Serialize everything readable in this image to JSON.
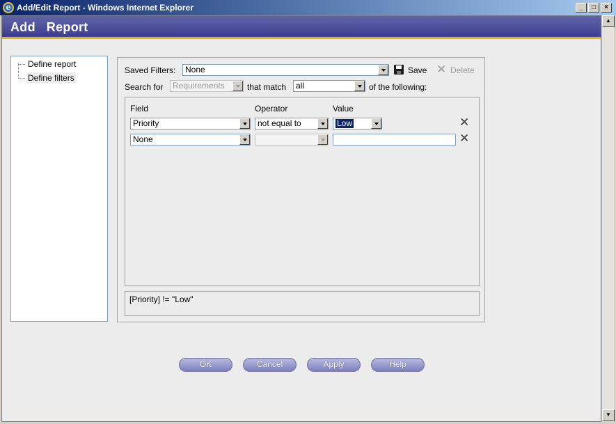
{
  "window": {
    "title": "Add/Edit Report - Windows Internet Explorer",
    "ie_icon": "e",
    "controls": [
      "_",
      "□",
      "×"
    ]
  },
  "header": {
    "title": "Add   Report"
  },
  "tree": {
    "items": [
      {
        "label": "Define report",
        "selected": false
      },
      {
        "label": "Define filters",
        "selected": true
      }
    ]
  },
  "filters": {
    "saved_filters_label": "Saved Filters:",
    "saved_filters_value": "None",
    "save_label": "Save",
    "delete_label": "Delete",
    "search_for_label": "Search for",
    "search_for_value": "Requirements",
    "that_match_label": "that match",
    "match_value": "all",
    "of_following_label": "of the following:",
    "columns": {
      "field": "Field",
      "operator": "Operator",
      "value": "Value"
    },
    "rows": [
      {
        "field": "Priority",
        "operator": "not equal to",
        "value": "Low"
      },
      {
        "field": "None",
        "operator": "",
        "value": ""
      }
    ],
    "expression": "[Priority] != \"Low\""
  },
  "buttons": {
    "ok": "OK",
    "cancel": "Cancel",
    "apply": "Apply",
    "help": "Help"
  },
  "icons": {
    "save": "floppy-disk-icon",
    "delete": "x-icon",
    "remove_row": "x-icon"
  },
  "colors": {
    "header_top": "#6163a8",
    "header_bottom": "#3d3f8f",
    "header_accent": "#f0b400",
    "button": "#8f91c9",
    "selection": "#0a246a"
  }
}
